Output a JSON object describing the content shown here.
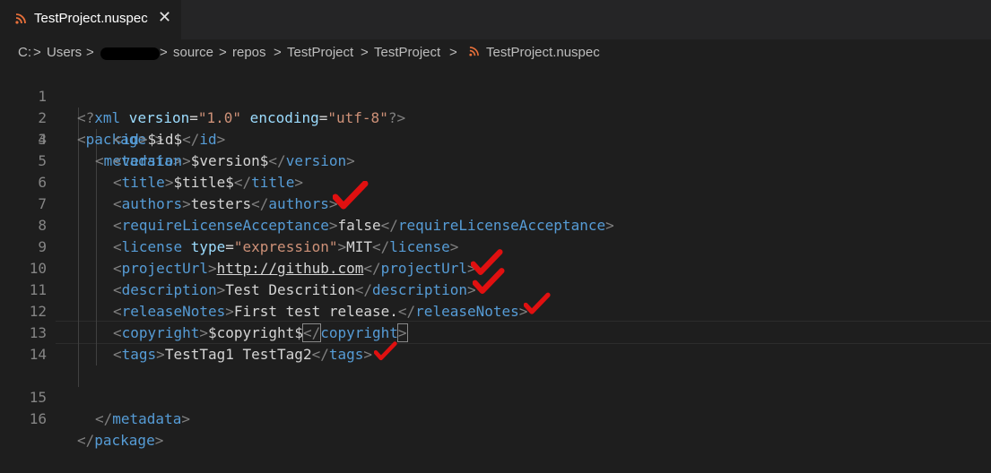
{
  "tab": {
    "title": "TestProject.nuspec",
    "close": "✕"
  },
  "breadcrumb": {
    "items": [
      "C:",
      "Users",
      "source",
      "repos",
      "TestProject",
      "TestProject",
      "TestProject.nuspec"
    ],
    "separator": ">"
  },
  "editor": {
    "line_numbers": [
      "1",
      "2",
      "3",
      "4",
      "5",
      "6",
      "7",
      "8",
      "9",
      "10",
      "11",
      "12",
      "13",
      "14",
      "15",
      "16"
    ],
    "lines": {
      "l1": {
        "open": "<?",
        "tag": "xml",
        "attr1": " version",
        "eq1": "=",
        "val1": "\"1.0\"",
        "attr2": " encoding",
        "eq2": "=",
        "val2": "\"utf-8\"",
        "close": "?>"
      },
      "l2": {
        "lt": "<",
        "tag": "package",
        "gt": " >"
      },
      "l3": {
        "lt": "<",
        "tag": "metadata",
        "gt": ">"
      },
      "l4": {
        "tag": "id",
        "text": "$id$"
      },
      "l5": {
        "tag": "version",
        "text": "$version$"
      },
      "l6": {
        "tag": "title",
        "text": "$title$"
      },
      "l7": {
        "tag": "authors",
        "text": "testers"
      },
      "l8": {
        "tag": "requireLicenseAcceptance",
        "text": "false"
      },
      "l9": {
        "tag": "license",
        "attr": " type",
        "eq": "=",
        "val": "\"expression\"",
        "text": "MIT"
      },
      "l10": {
        "tag": "projectUrl",
        "text": "http://github.com"
      },
      "l11": {
        "tag": "description",
        "text": "Test Descrition"
      },
      "l12": {
        "tag": "releaseNotes",
        "text": "First test release."
      },
      "l13": {
        "tag": "copyright",
        "text": "$copyright$"
      },
      "l14": {
        "tag": "tags",
        "text": "TestTag1 TestTag2"
      },
      "l15": {
        "tag": "metadata"
      },
      "l16": {
        "tag": "package"
      }
    }
  },
  "colors": {
    "tag": "#569cd6",
    "punct": "#808080",
    "attr": "#9cdcfe",
    "string": "#ce9178",
    "text": "#d4d4d4",
    "check": "#e01010",
    "rss": "#e8703a"
  }
}
